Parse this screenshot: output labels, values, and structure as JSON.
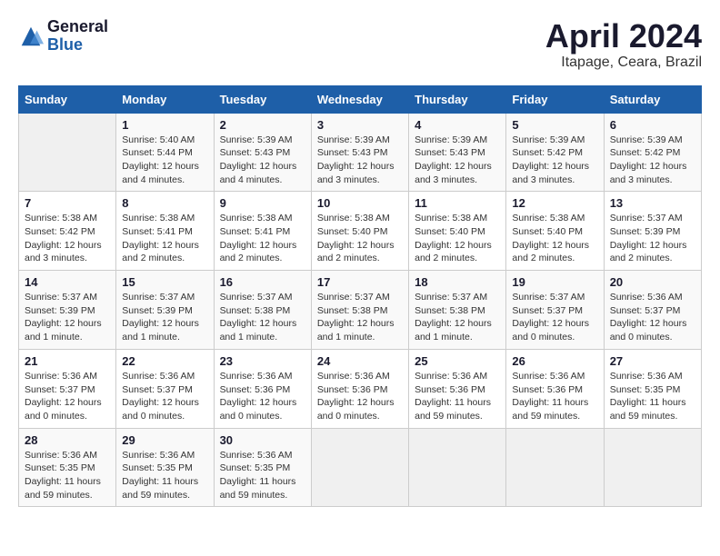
{
  "header": {
    "logo_general": "General",
    "logo_blue": "Blue",
    "month_title": "April 2024",
    "location": "Itapage, Ceara, Brazil"
  },
  "columns": [
    "Sunday",
    "Monday",
    "Tuesday",
    "Wednesday",
    "Thursday",
    "Friday",
    "Saturday"
  ],
  "weeks": [
    [
      {
        "day": "",
        "info": ""
      },
      {
        "day": "1",
        "info": "Sunrise: 5:40 AM\nSunset: 5:44 PM\nDaylight: 12 hours\nand 4 minutes."
      },
      {
        "day": "2",
        "info": "Sunrise: 5:39 AM\nSunset: 5:43 PM\nDaylight: 12 hours\nand 4 minutes."
      },
      {
        "day": "3",
        "info": "Sunrise: 5:39 AM\nSunset: 5:43 PM\nDaylight: 12 hours\nand 3 minutes."
      },
      {
        "day": "4",
        "info": "Sunrise: 5:39 AM\nSunset: 5:43 PM\nDaylight: 12 hours\nand 3 minutes."
      },
      {
        "day": "5",
        "info": "Sunrise: 5:39 AM\nSunset: 5:42 PM\nDaylight: 12 hours\nand 3 minutes."
      },
      {
        "day": "6",
        "info": "Sunrise: 5:39 AM\nSunset: 5:42 PM\nDaylight: 12 hours\nand 3 minutes."
      }
    ],
    [
      {
        "day": "7",
        "info": "Sunrise: 5:38 AM\nSunset: 5:42 PM\nDaylight: 12 hours\nand 3 minutes."
      },
      {
        "day": "8",
        "info": "Sunrise: 5:38 AM\nSunset: 5:41 PM\nDaylight: 12 hours\nand 2 minutes."
      },
      {
        "day": "9",
        "info": "Sunrise: 5:38 AM\nSunset: 5:41 PM\nDaylight: 12 hours\nand 2 minutes."
      },
      {
        "day": "10",
        "info": "Sunrise: 5:38 AM\nSunset: 5:40 PM\nDaylight: 12 hours\nand 2 minutes."
      },
      {
        "day": "11",
        "info": "Sunrise: 5:38 AM\nSunset: 5:40 PM\nDaylight: 12 hours\nand 2 minutes."
      },
      {
        "day": "12",
        "info": "Sunrise: 5:38 AM\nSunset: 5:40 PM\nDaylight: 12 hours\nand 2 minutes."
      },
      {
        "day": "13",
        "info": "Sunrise: 5:37 AM\nSunset: 5:39 PM\nDaylight: 12 hours\nand 2 minutes."
      }
    ],
    [
      {
        "day": "14",
        "info": "Sunrise: 5:37 AM\nSunset: 5:39 PM\nDaylight: 12 hours\nand 1 minute."
      },
      {
        "day": "15",
        "info": "Sunrise: 5:37 AM\nSunset: 5:39 PM\nDaylight: 12 hours\nand 1 minute."
      },
      {
        "day": "16",
        "info": "Sunrise: 5:37 AM\nSunset: 5:38 PM\nDaylight: 12 hours\nand 1 minute."
      },
      {
        "day": "17",
        "info": "Sunrise: 5:37 AM\nSunset: 5:38 PM\nDaylight: 12 hours\nand 1 minute."
      },
      {
        "day": "18",
        "info": "Sunrise: 5:37 AM\nSunset: 5:38 PM\nDaylight: 12 hours\nand 1 minute."
      },
      {
        "day": "19",
        "info": "Sunrise: 5:37 AM\nSunset: 5:37 PM\nDaylight: 12 hours\nand 0 minutes."
      },
      {
        "day": "20",
        "info": "Sunrise: 5:36 AM\nSunset: 5:37 PM\nDaylight: 12 hours\nand 0 minutes."
      }
    ],
    [
      {
        "day": "21",
        "info": "Sunrise: 5:36 AM\nSunset: 5:37 PM\nDaylight: 12 hours\nand 0 minutes."
      },
      {
        "day": "22",
        "info": "Sunrise: 5:36 AM\nSunset: 5:37 PM\nDaylight: 12 hours\nand 0 minutes."
      },
      {
        "day": "23",
        "info": "Sunrise: 5:36 AM\nSunset: 5:36 PM\nDaylight: 12 hours\nand 0 minutes."
      },
      {
        "day": "24",
        "info": "Sunrise: 5:36 AM\nSunset: 5:36 PM\nDaylight: 12 hours\nand 0 minutes."
      },
      {
        "day": "25",
        "info": "Sunrise: 5:36 AM\nSunset: 5:36 PM\nDaylight: 11 hours\nand 59 minutes."
      },
      {
        "day": "26",
        "info": "Sunrise: 5:36 AM\nSunset: 5:36 PM\nDaylight: 11 hours\nand 59 minutes."
      },
      {
        "day": "27",
        "info": "Sunrise: 5:36 AM\nSunset: 5:35 PM\nDaylight: 11 hours\nand 59 minutes."
      }
    ],
    [
      {
        "day": "28",
        "info": "Sunrise: 5:36 AM\nSunset: 5:35 PM\nDaylight: 11 hours\nand 59 minutes."
      },
      {
        "day": "29",
        "info": "Sunrise: 5:36 AM\nSunset: 5:35 PM\nDaylight: 11 hours\nand 59 minutes."
      },
      {
        "day": "30",
        "info": "Sunrise: 5:36 AM\nSunset: 5:35 PM\nDaylight: 11 hours\nand 59 minutes."
      },
      {
        "day": "",
        "info": ""
      },
      {
        "day": "",
        "info": ""
      },
      {
        "day": "",
        "info": ""
      },
      {
        "day": "",
        "info": ""
      }
    ]
  ]
}
